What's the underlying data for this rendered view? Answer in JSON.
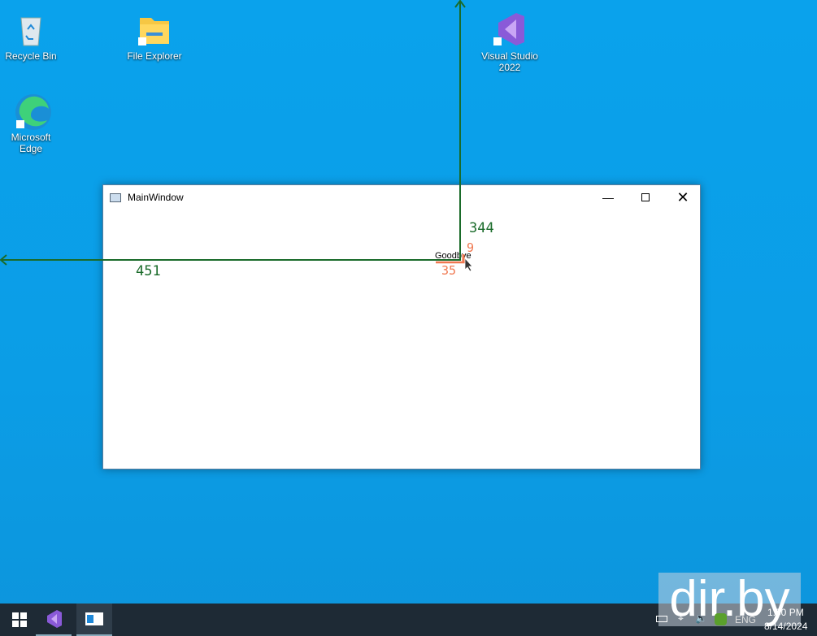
{
  "desktop": {
    "icons": [
      {
        "label": "Recycle Bin"
      },
      {
        "label": "File Explorer"
      },
      {
        "label": "Visual Studio 2022"
      },
      {
        "label": "Microsoft Edge"
      }
    ]
  },
  "window": {
    "title": "MainWindow",
    "content_text": "Goodbye"
  },
  "overlay": {
    "vertical_value": "344",
    "horizontal_value": "451",
    "small_vertical": "9",
    "small_horizontal": "35",
    "green": "#1a6b2a",
    "orange": "#f07850"
  },
  "taskbar": {
    "language": "ENG",
    "time": "1:30 PM",
    "date": "8/14/2024"
  },
  "watermark": "dir.by"
}
